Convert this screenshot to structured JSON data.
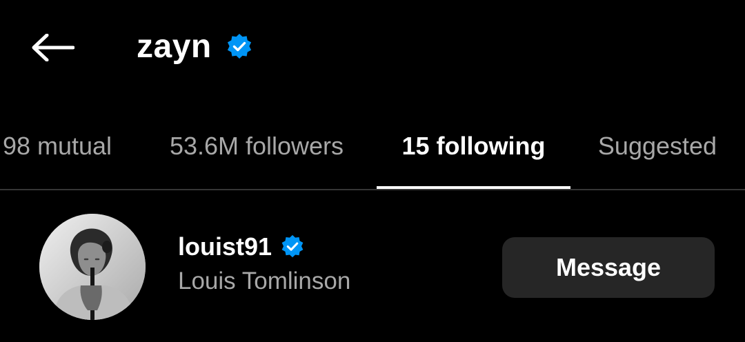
{
  "header": {
    "back_icon": "arrow-left-icon",
    "title": "zayn",
    "verified_icon": "verified-badge-icon"
  },
  "tabs": [
    {
      "label": "98 mutual",
      "active": false
    },
    {
      "label": "53.6M followers",
      "active": false
    },
    {
      "label": "15 following",
      "active": true
    },
    {
      "label": "Suggested",
      "active": false
    }
  ],
  "list": [
    {
      "username": "louist91",
      "verified": true,
      "full_name": "Louis Tomlinson",
      "action_label": "Message"
    }
  ],
  "colors": {
    "background": "#000000",
    "primary_text": "#ffffff",
    "secondary_text": "#a8a8a8",
    "verified_blue": "#0095f6",
    "button_bg": "#262626",
    "divider": "#363636"
  }
}
